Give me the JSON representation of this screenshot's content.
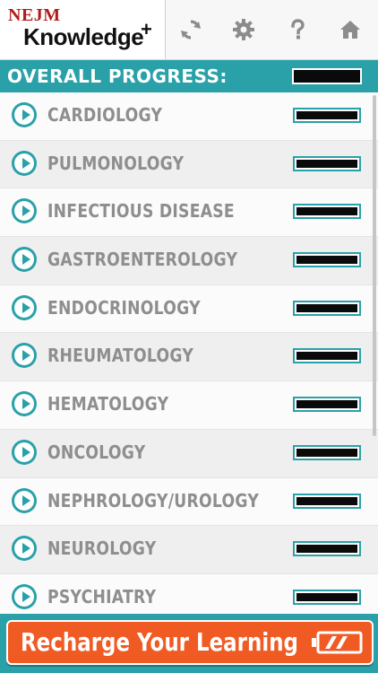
{
  "header": {
    "logo_brand": "NEJM",
    "logo_title": "Knowledge",
    "logo_plus": "+",
    "icons": [
      "sync-icon",
      "gear-icon",
      "help-icon",
      "home-icon"
    ]
  },
  "overall": {
    "label": "OVERALL PROGRESS:"
  },
  "topics": [
    {
      "label": "CARDIOLOGY"
    },
    {
      "label": "PULMONOLOGY"
    },
    {
      "label": "INFECTIOUS DISEASE"
    },
    {
      "label": "GASTROENTEROLOGY"
    },
    {
      "label": "ENDOCRINOLOGY"
    },
    {
      "label": "RHEUMATOLOGY"
    },
    {
      "label": "HEMATOLOGY"
    },
    {
      "label": "ONCOLOGY"
    },
    {
      "label": "NEPHROLOGY/UROLOGY"
    },
    {
      "label": "NEUROLOGY"
    },
    {
      "label": "PSYCHIATRY"
    }
  ],
  "footer": {
    "recharge_label": "Recharge Your Learning",
    "battery_icon": "battery-icon"
  },
  "colors": {
    "teal": "#2aa1a8",
    "orange": "#f05a23",
    "brand_red": "#b31b1b"
  }
}
